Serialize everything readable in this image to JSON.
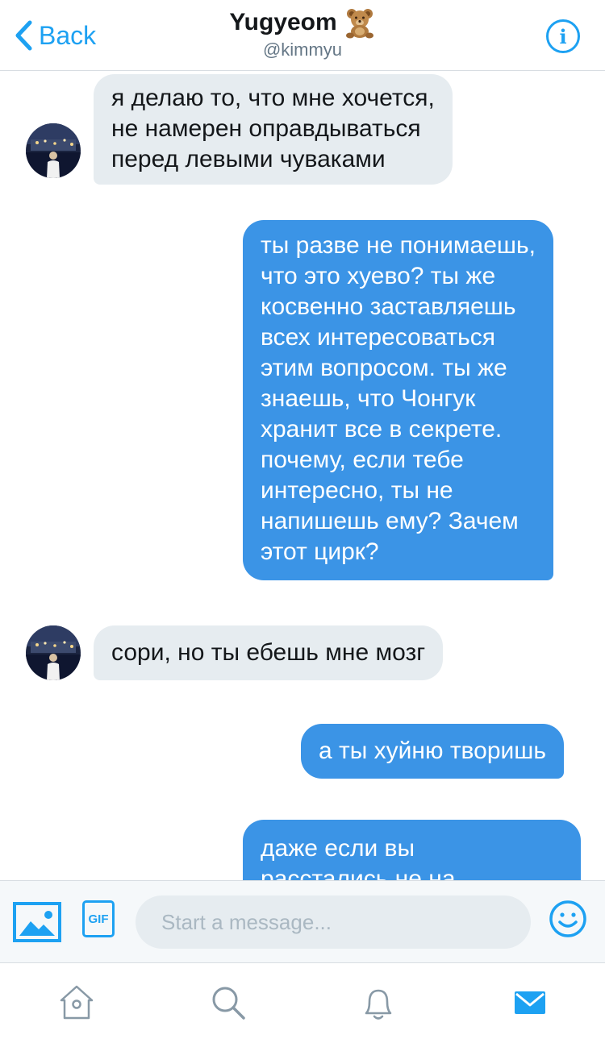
{
  "header": {
    "back_label": "Back",
    "title": "Yugyeom",
    "title_emoji": "teddy-bear-emoji",
    "handle": "@kimmyu",
    "info_icon": "info-icon"
  },
  "messages": [
    {
      "side": "in",
      "lines": [
        "я делаю то, что мне хочется,",
        "не намерен оправдываться",
        "перед левыми чуваками"
      ]
    },
    {
      "side": "out",
      "lines": [
        "ты разве не понимаешь,",
        "что это хуево? ты же",
        "косвенно заставляешь",
        "всех интересоваться",
        "этим вопросом. ты же",
        "знаешь, что Чонгук",
        "хранит все в секрете.",
        "почему, если тебе",
        "интересно, ты не",
        "напишешь ему? Зачем",
        "этот цирк?"
      ]
    },
    {
      "side": "in",
      "lines": [
        "сори, но ты ебешь мне мозг"
      ]
    },
    {
      "side": "out",
      "lines": [
        "а ты хуйню творишь"
      ]
    },
    {
      "side": "out",
      "lines": [
        "даже если вы",
        "расстались не на"
      ]
    }
  ],
  "composer": {
    "placeholder": "Start a message...",
    "gif_label": "GIF",
    "photo_icon": "photo-icon",
    "emoji_icon": "smiley-icon"
  },
  "tabbar": {
    "items": [
      "home-icon",
      "search-icon",
      "notifications-icon",
      "messages-icon"
    ],
    "active": "messages-icon"
  },
  "colors": {
    "accent": "#1da1f2",
    "outgoing_bubble": "#3b94e6",
    "incoming_bubble": "#e6ecf0",
    "secondary_text": "#657786"
  }
}
